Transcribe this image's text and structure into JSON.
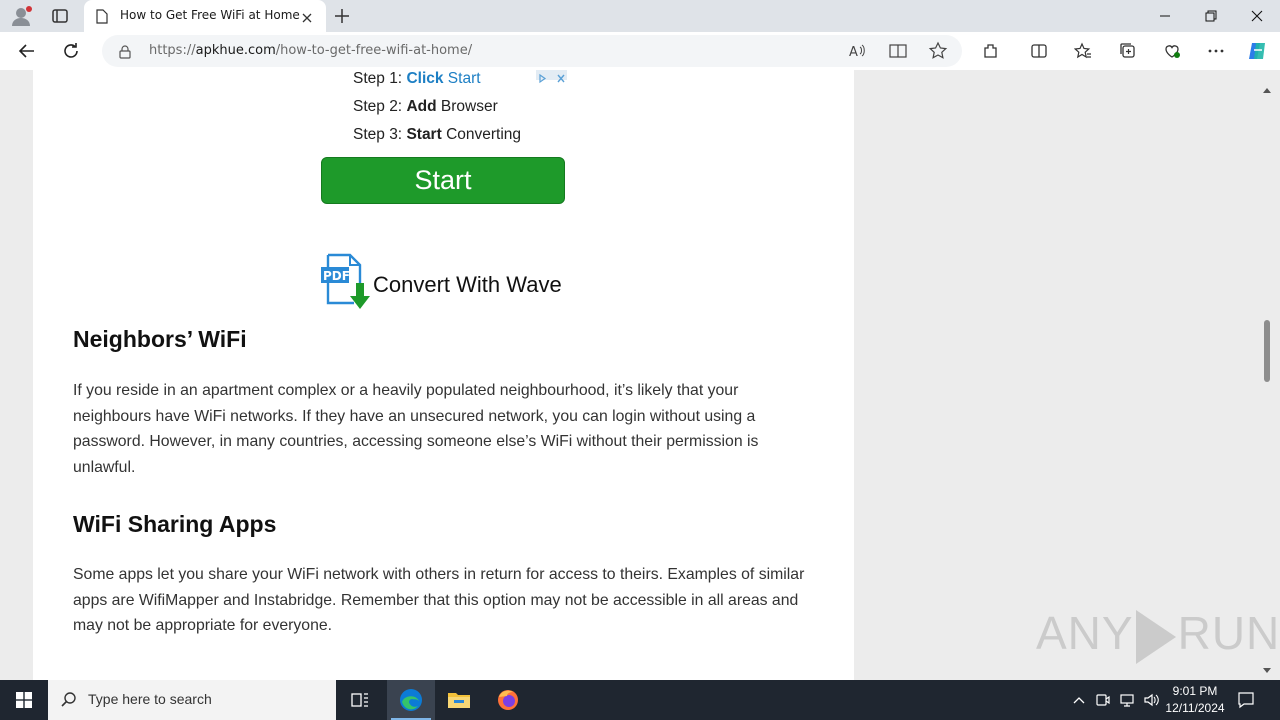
{
  "browser": {
    "tab_title": "How to Get Free WiFi at Home",
    "url_protocol": "https://",
    "url_host": "apkhue.com",
    "url_path": "/how-to-get-free-wifi-at-home/"
  },
  "ad": {
    "steps": [
      {
        "prefix": "Step 1: ",
        "bold": "Click",
        "rest": " Start"
      },
      {
        "prefix": "Step 2: ",
        "bold": "Add",
        "rest": " Browser"
      },
      {
        "prefix": "Step 3: ",
        "bold": "Start",
        "rest": " Converting"
      }
    ],
    "button_label": "Start",
    "logo_label": "PDF",
    "brand_text": "Convert With Wave"
  },
  "article": {
    "section1_heading": "Neighbors’ WiFi",
    "section1_body": "If you reside in an apartment complex or a heavily populated neighbourhood, it’s likely that your neighbours have WiFi networks. If they have an unsecured network, you can login without using a password. However, in many countries, accessing someone else’s WiFi without their permission is unlawful.",
    "section2_heading": "WiFi Sharing Apps",
    "section2_body": "Some apps let you share your WiFi network with others in return for access to theirs. Examples of similar apps are WifiMapper and Instabridge. Remember that this option may not be accessible in all areas and may not be appropriate for everyone."
  },
  "watermark": {
    "left": "ANY",
    "right": "RUN"
  },
  "taskbar": {
    "search_placeholder": "Type here to search",
    "time": "9:01 PM",
    "date": "12/11/2024"
  }
}
